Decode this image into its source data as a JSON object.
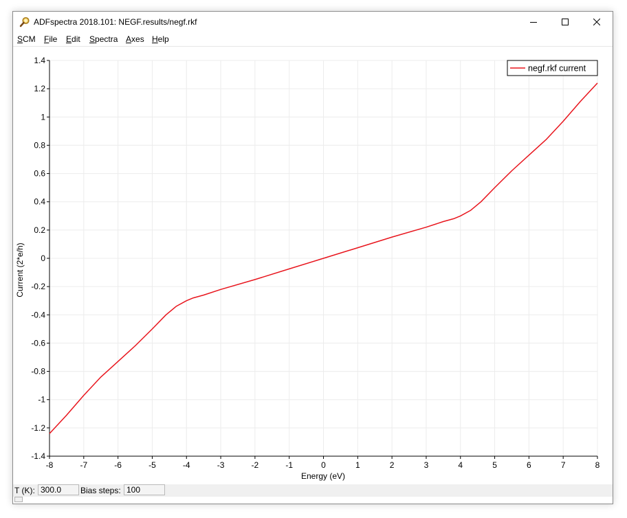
{
  "window": {
    "title": "ADFspectra 2018.101: NEGF.results/negf.rkf",
    "icon": "magnifier-app-icon"
  },
  "menubar": {
    "items": [
      {
        "label": "SCM",
        "accel": "S",
        "rest": "CM"
      },
      {
        "label": "File",
        "accel": "F",
        "rest": "ile"
      },
      {
        "label": "Edit",
        "accel": "E",
        "rest": "dit"
      },
      {
        "label": "Spectra",
        "accel": "S",
        "rest": "pectra"
      },
      {
        "label": "Axes",
        "accel": "A",
        "rest": "xes"
      },
      {
        "label": "Help",
        "accel": "H",
        "rest": "elp"
      }
    ]
  },
  "statusbar": {
    "temperature_label": "T (K):",
    "temperature_value": "300.0",
    "bias_steps_label": "Bias steps:",
    "bias_steps_value": "100"
  },
  "chart_data": {
    "type": "line",
    "xlabel": "Energy (eV)",
    "ylabel": "Current (2*e/h)",
    "xlim": [
      -8,
      8
    ],
    "ylim": [
      -1.4,
      1.4
    ],
    "xticks": [
      -8,
      -7,
      -6,
      -5,
      -4,
      -3,
      -2,
      -1,
      0,
      1,
      2,
      3,
      4,
      5,
      6,
      7,
      8
    ],
    "yticks": [
      -1.4,
      -1.2,
      -1,
      -0.8,
      -0.6,
      -0.4,
      -0.2,
      0,
      0.2,
      0.4,
      0.6,
      0.8,
      1,
      1.2,
      1.4
    ],
    "grid": true,
    "legend_position": "top-right",
    "series": [
      {
        "name": "negf.rkf current",
        "color": "#e8141c",
        "x": [
          -8,
          -7.5,
          -7,
          -6.5,
          -6,
          -5.5,
          -5,
          -4.6,
          -4.3,
          -4,
          -3.8,
          -3.5,
          -3,
          -2,
          -1,
          0,
          1,
          2,
          3,
          3.5,
          3.8,
          4,
          4.3,
          4.6,
          5,
          5.5,
          6,
          6.5,
          7,
          7.5,
          8
        ],
        "y": [
          -1.24,
          -1.11,
          -0.97,
          -0.84,
          -0.73,
          -0.62,
          -0.5,
          -0.4,
          -0.34,
          -0.3,
          -0.28,
          -0.26,
          -0.22,
          -0.15,
          -0.075,
          0,
          0.075,
          0.15,
          0.22,
          0.26,
          0.28,
          0.3,
          0.34,
          0.4,
          0.5,
          0.62,
          0.73,
          0.84,
          0.97,
          1.11,
          1.24
        ]
      }
    ]
  },
  "colors": {
    "curve": "#e8141c",
    "grid": "#ececec",
    "axis": "#000000"
  }
}
